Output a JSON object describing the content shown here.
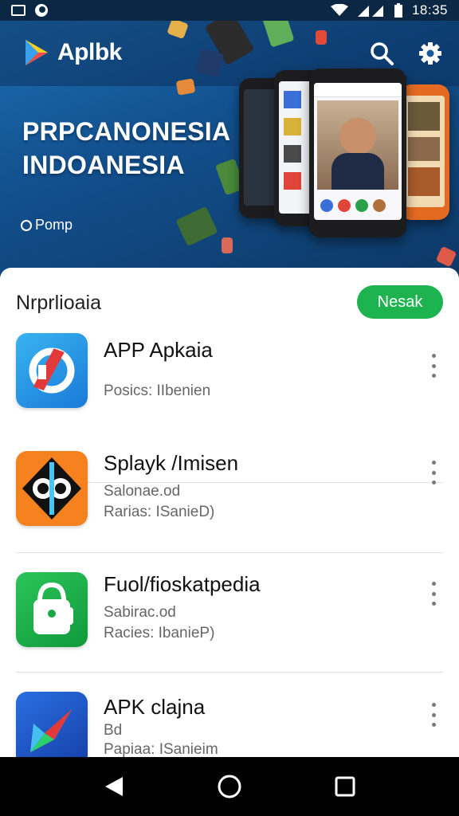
{
  "status_bar": {
    "time": "18:35"
  },
  "header": {
    "logo_text": "Aplbk",
    "hero_title_line1": "PRPCANONESIA",
    "hero_title_line2": "INDOANESIA",
    "hero_sub": "Pomp",
    "search_icon": "search-icon",
    "settings_icon": "gear-icon"
  },
  "section": {
    "title": "Nrprlioaia",
    "more_label": "Nesak"
  },
  "apps": [
    {
      "name": "APP Apkaia",
      "meta1": "",
      "meta2": "Posics: IIbenien",
      "icon": "blue-logo-icon"
    },
    {
      "name": "Splayk /Imisen",
      "meta1": "Salonae.od",
      "meta2": "Rarias: ISanieD)",
      "icon": "orange-logo-icon"
    },
    {
      "name": "Fuol/fioskatpedia",
      "meta1": "Sabirac.od",
      "meta2": "Racies: IbanieP)",
      "icon": "green-bag-icon"
    },
    {
      "name": "APK clajna",
      "meta1": "Bd",
      "meta2": "Papiaa: ISanieim",
      "icon": "play-triangle-icon"
    }
  ],
  "colors": {
    "accent_green": "#1db34f",
    "hero_blue": "#12508e",
    "status_bar": "#0b2744"
  }
}
